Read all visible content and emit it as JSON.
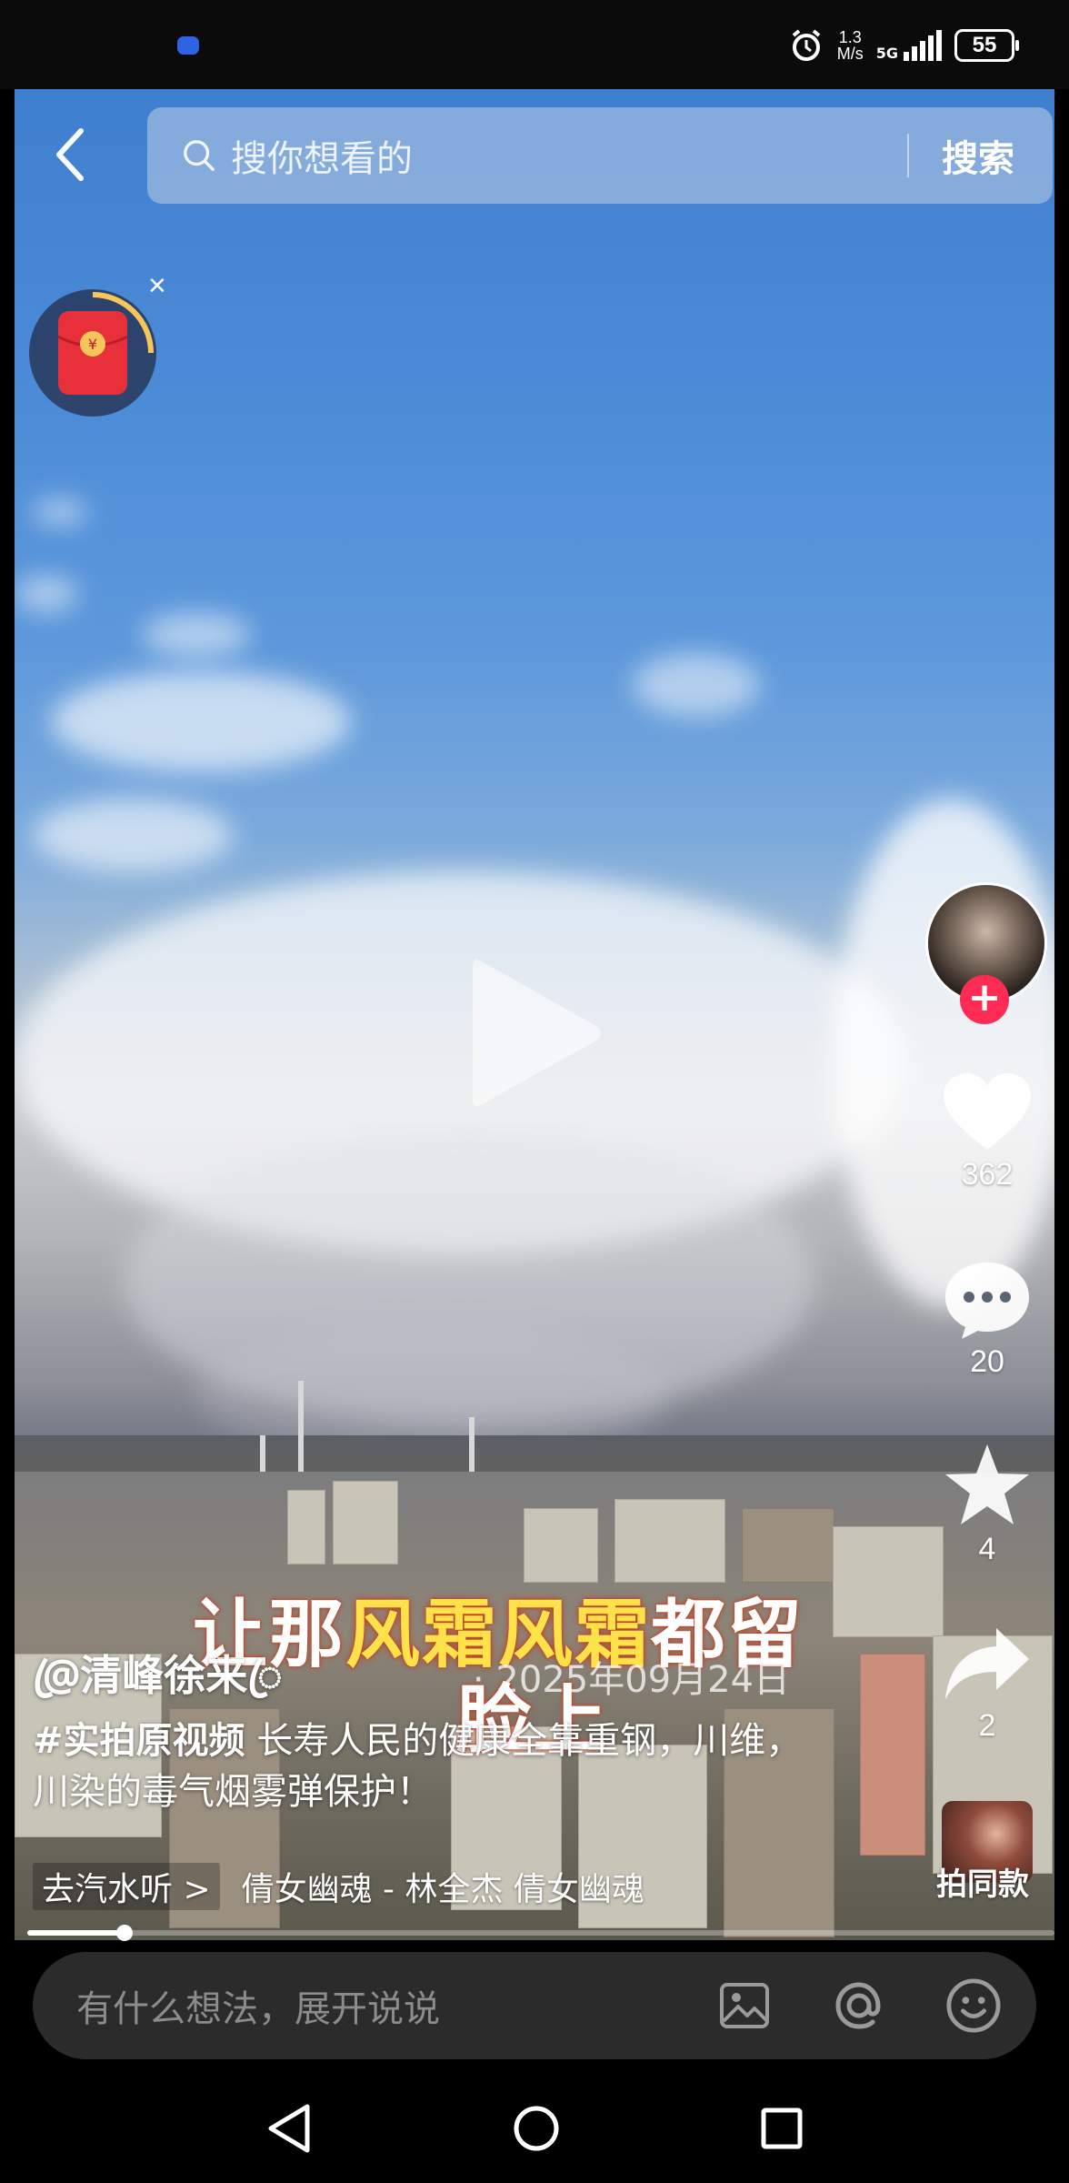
{
  "status_bar": {
    "network_speed": "1.3\nM/s",
    "network_speed_value": "1.3",
    "network_speed_unit": "M/s",
    "network_type": "5G",
    "battery": "55"
  },
  "search": {
    "placeholder": "搜你想看的",
    "button_label": "搜索"
  },
  "video": {
    "overlay_caption_line1_a": "让那",
    "overlay_caption_line1_b": "风霜风霜",
    "overlay_caption_line1_c": "都留",
    "overlay_caption_line2": "脸上",
    "progress_fraction": 0.095
  },
  "side_rail": {
    "like_count": "362",
    "comment_count": "20",
    "favorite_count": "4",
    "share_count": "2"
  },
  "post": {
    "username": "@ꦿ清峰徐来ꦿ",
    "date": "· 2025年09月24日",
    "hashtag": "#实拍原视频",
    "description": " 长寿人民的健康全靠重钢，川维，川染的毒气烟雾弹保护！",
    "music_tag": "去汽水听 >",
    "music_title": "倩女幽魂 - 林全杰   倩女幽魂"
  },
  "remix": {
    "label": "拍同款"
  },
  "comment_box": {
    "placeholder": "有什么想法，展开说说"
  },
  "colors": {
    "accent_red": "#fe2c55",
    "caption_yellow": "#ffe24a",
    "comment_bar_bg": "#2b2b2b"
  },
  "icons": [
    "back-icon",
    "search-icon",
    "red-packet-icon",
    "close-icon",
    "play-icon",
    "heart-icon",
    "comment-icon",
    "star-icon",
    "share-icon",
    "image-icon",
    "at-icon",
    "emoji-icon",
    "nav-back-icon",
    "nav-home-icon",
    "nav-recents-icon",
    "alarm-icon",
    "signal-icon",
    "battery-icon"
  ]
}
